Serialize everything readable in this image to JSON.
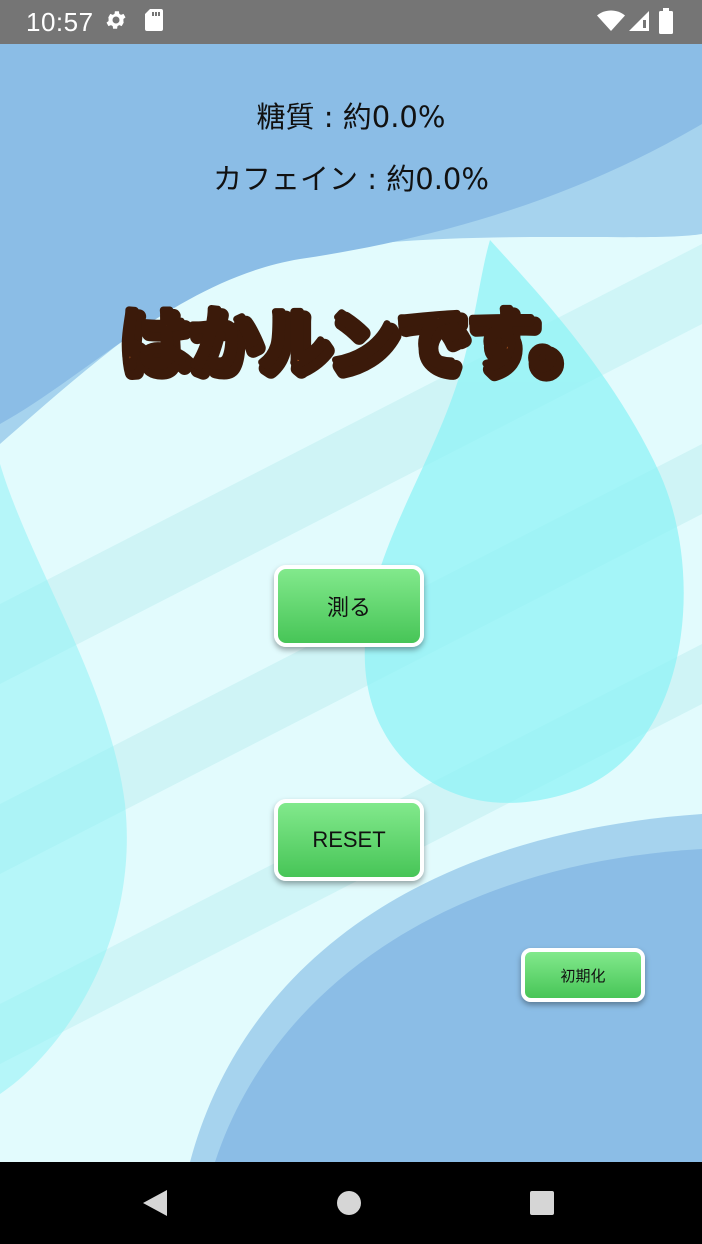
{
  "status_bar": {
    "time": "10:57",
    "left_icons": [
      "gear-icon",
      "sd-card-icon"
    ],
    "right_icons": [
      "wifi-icon",
      "signal-icon",
      "battery-icon"
    ],
    "background_color": "#757575"
  },
  "readouts": {
    "sugar": "糖質 : 約0.0%",
    "caffeine": "カフェイン : 約0.0%"
  },
  "logo": {
    "text": "はかルンです。",
    "fill_color": "#f47a2c",
    "outline_color": "#3b1a0a"
  },
  "buttons": {
    "measure": "測る",
    "reset": "RESET",
    "initialize": "初期化"
  },
  "colors": {
    "button_gradient_top": "#82e98c",
    "button_gradient_bottom": "#47c557",
    "background_blue": "#8bbde6",
    "background_light": "#e2fbfd",
    "drop_cyan": "#8ff3f6"
  },
  "nav_bar": {
    "icons": [
      "back-icon",
      "home-icon",
      "recents-icon"
    ]
  }
}
